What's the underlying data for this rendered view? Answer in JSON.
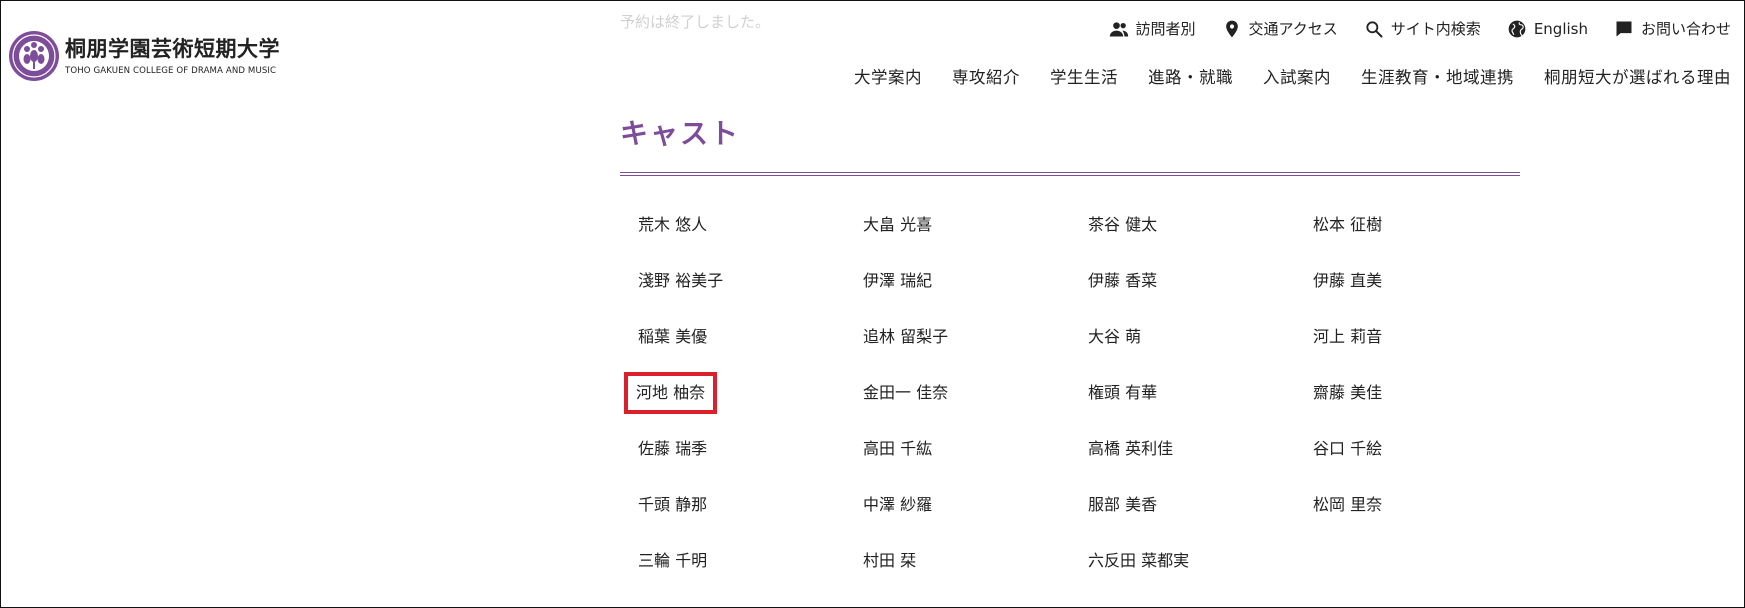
{
  "header": {
    "logo_name": "桐朋学園芸術短期大学",
    "logo_name_en": "TOHO GAKUEN COLLEGE OF DRAMA AND MUSIC",
    "notice": "予約は終了しました。",
    "utility_nav": [
      {
        "label": "訪問者別",
        "icon": "people-icon"
      },
      {
        "label": "交通アクセス",
        "icon": "location-pin-icon"
      },
      {
        "label": "サイト内検索",
        "icon": "search-icon"
      },
      {
        "label": "English",
        "icon": "globe-icon"
      },
      {
        "label": "お問い合わせ",
        "icon": "chat-icon"
      }
    ],
    "main_nav": [
      {
        "label": "大学案内"
      },
      {
        "label": "専攻紹介"
      },
      {
        "label": "学生生活"
      },
      {
        "label": "進路・就職"
      },
      {
        "label": "入試案内"
      },
      {
        "label": "生涯教育・地域連携"
      },
      {
        "label": "桐朋短大が選ばれる理由"
      }
    ]
  },
  "main": {
    "section_title": "キャスト",
    "cast": [
      {
        "name": "荒木 悠人"
      },
      {
        "name": "大畠 光喜"
      },
      {
        "name": "茶谷 健太"
      },
      {
        "name": "松本 征樹"
      },
      {
        "name": "淺野 裕美子"
      },
      {
        "name": "伊澤 瑞紀"
      },
      {
        "name": "伊藤 香菜"
      },
      {
        "name": "伊藤 直美"
      },
      {
        "name": "稲葉 美優"
      },
      {
        "name": "追林 留梨子"
      },
      {
        "name": "大谷 萌"
      },
      {
        "name": "河上 莉音"
      },
      {
        "name": "河地 柚奈",
        "highlighted": true
      },
      {
        "name": "金田一 佳奈"
      },
      {
        "name": "権頭 有華"
      },
      {
        "name": "齋藤 美佳"
      },
      {
        "name": "佐藤 瑞季"
      },
      {
        "name": "高田 千紘"
      },
      {
        "name": "高橋 英利佳"
      },
      {
        "name": "谷口 千絵"
      },
      {
        "name": "千頭 静那"
      },
      {
        "name": "中澤 紗羅"
      },
      {
        "name": "服部 美香"
      },
      {
        "name": "松岡 里奈"
      },
      {
        "name": "三輪 千明"
      },
      {
        "name": "村田 栞"
      },
      {
        "name": "六反田 菜都実"
      }
    ]
  },
  "colors": {
    "accent": "#7d4d9a",
    "highlight": "#d9202b",
    "notice_text": "#d0d0d0"
  }
}
